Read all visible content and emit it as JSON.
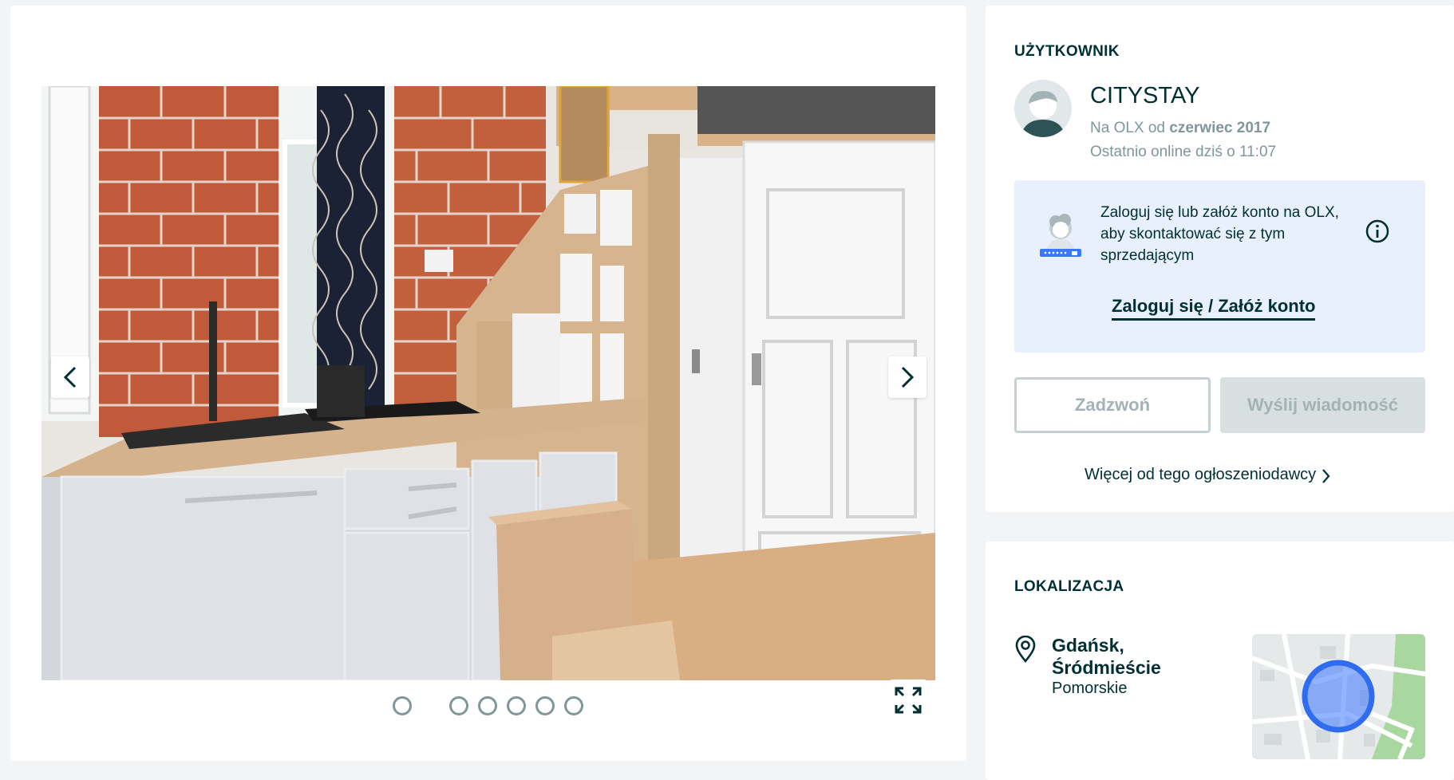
{
  "gallery": {
    "image_alt": "Kuchnia z ceglaną ścianą i drzwiami",
    "prev_icon": "chevron-left-icon",
    "next_icon": "chevron-right-icon",
    "dot_count": 6,
    "active_dot": 0,
    "fullscreen_icon": "expand-icon"
  },
  "user": {
    "section_title": "UŻYTKOWNIK",
    "name": "CITYSTAY",
    "since_prefix": "Na OLX od ",
    "since_value": "czerwiec 2017",
    "last_online": "Ostatnio online dziś o 11:07",
    "login_prompt": "Zaloguj się lub załóż konto na OLX, aby skontaktować się z tym sprzedającym",
    "login_link": "Zaloguj się / Załóż konto",
    "call_button": "Zadzwoń",
    "message_button": "Wyślij wiadomość",
    "more_link": "Więcej od tego ogłoszeniodawcy"
  },
  "location": {
    "section_title": "LOKALIZACJA",
    "city_line1": "Gdańsk,",
    "city_line2": "Śródmieście",
    "region": "Pomorskie"
  },
  "colors": {
    "text_primary": "#002f34",
    "text_muted": "#7f9799",
    "login_box_bg": "#e8f0fd",
    "map_marker": "#3a77ff"
  }
}
